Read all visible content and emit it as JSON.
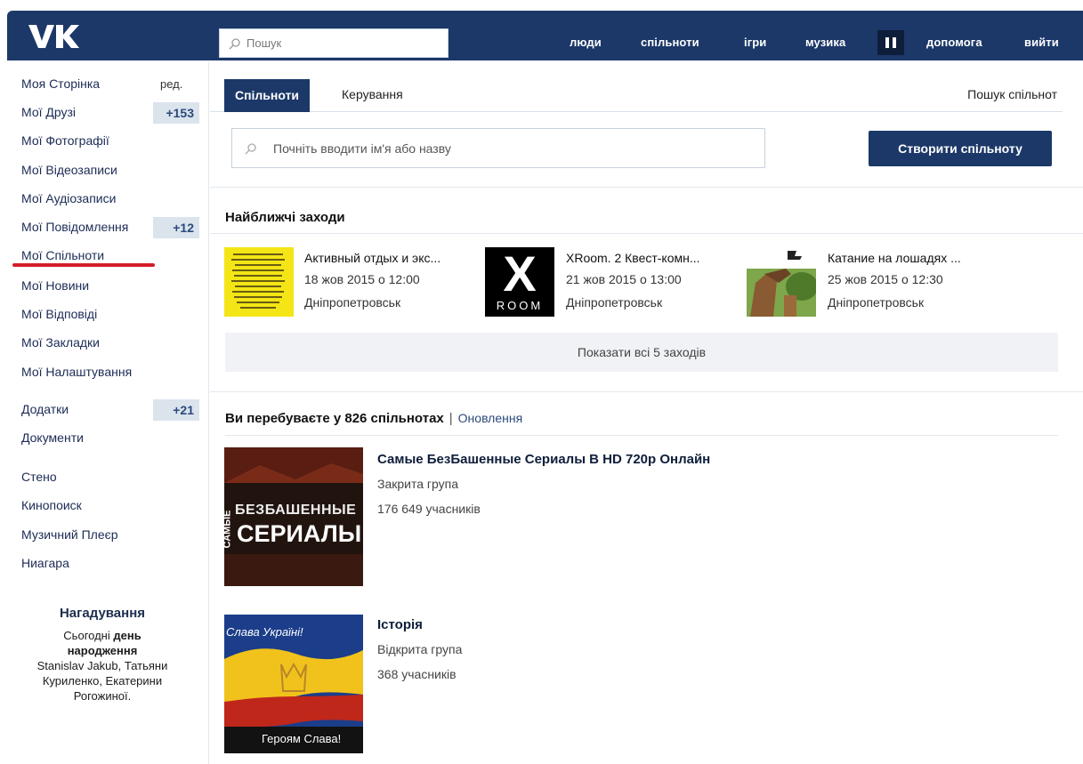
{
  "header": {
    "logo": "VK",
    "search_placeholder": "Пошук",
    "nav": [
      "люди",
      "спільноти",
      "ігри",
      "музика",
      "допомога",
      "вийти"
    ]
  },
  "sidebar": {
    "items": [
      {
        "label": "Моя Сторінка",
        "extra": "ред."
      },
      {
        "label": "Мої Друзі",
        "badge": "+153"
      },
      {
        "label": "Мої Фотографії"
      },
      {
        "label": "Мої Відеозаписи"
      },
      {
        "label": "Мої Аудіозаписи"
      },
      {
        "label": "Мої Повідомлення",
        "badge": "+12"
      },
      {
        "label": "Мої Спільноти"
      },
      {
        "label": "Мої Новини"
      },
      {
        "label": "Мої Відповіді"
      },
      {
        "label": "Мої Закладки"
      },
      {
        "label": "Мої Налаштування"
      },
      {
        "label": "Додатки",
        "badge": "+21"
      },
      {
        "label": "Документи"
      },
      {
        "label": "Стено"
      },
      {
        "label": "Кинопоиск"
      },
      {
        "label": "Музичний Плеєр"
      },
      {
        "label": "Ниагара"
      }
    ],
    "reminder": {
      "title": "Нагадування",
      "line1": "Сьогодні",
      "bold1": "день",
      "bold2": "народження",
      "names": "Stanislav Jakub, Татьяни Куриленко, Екатерини Рогожиної."
    }
  },
  "main": {
    "tabs": {
      "active": "Спільноти",
      "manage": "Керування",
      "search": "Пошук спільнот"
    },
    "community_search_placeholder": "Почніть вводити ім'я або назву",
    "create_button": "Створити спільноту",
    "events_title": "Найближчі заходи",
    "events": [
      {
        "name": "Активный отдых и экс...",
        "date": "18 жов 2015 о 12:00",
        "city": "Дніпропетровськ"
      },
      {
        "name": "XRoom. 2 Квест-комн...",
        "date": "21 жов 2015 о 13:00",
        "city": "Дніпропетровськ",
        "thumb_text": "X",
        "thumb_sub": "ROOM"
      },
      {
        "name": "Катание на лошадях ...",
        "date": "25 жов 2015 о 12:30",
        "city": "Дніпропетровськ"
      }
    ],
    "show_all": "Показати всі 5 заходів",
    "groups_title": "Ви перебуваєте у 826 спільнотах",
    "groups_updates": "Оновлення",
    "groups": [
      {
        "name": "Самые БезБашенные Сериалы В HD 720p Онлайн",
        "type": "Закрита група",
        "members": "176 649 учасників",
        "thumb_small": "САМЫЕ",
        "thumb_line1": "БЕЗБАШЕННЫЕ",
        "thumb_line2": "СЕРИАЛЫ"
      },
      {
        "name": "Історія",
        "type": "Відкрита група",
        "members": "368 учасників",
        "thumb_top": "Слава Україні!",
        "thumb_bottom": "Героям Слава!"
      }
    ]
  },
  "colors": {
    "header": "#1c3868",
    "accent_red": "#d51c2a",
    "badge_bg": "#dbe3ed"
  }
}
